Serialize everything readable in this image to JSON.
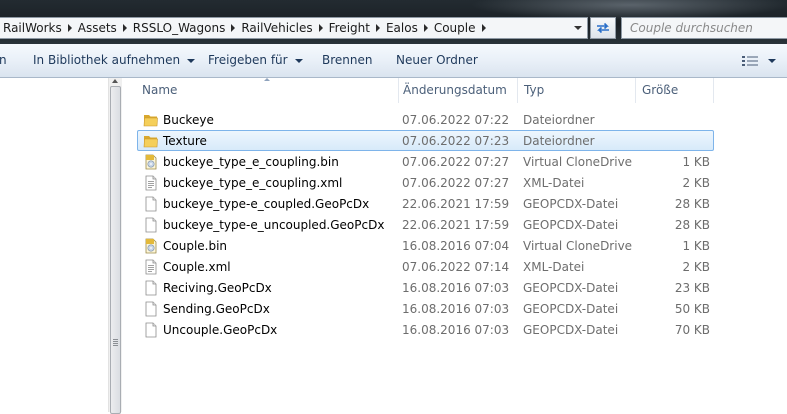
{
  "address_bar": {
    "crumbs": [
      "RailWorks",
      "Assets",
      "RSSLO_Wagons",
      "RailVehicles",
      "Freight",
      "Ealos",
      "Couple"
    ]
  },
  "search": {
    "placeholder": "Couple durchsuchen"
  },
  "toolbar": {
    "organize_partial": "n",
    "library_label": "In Bibliothek aufnehmen",
    "share_label": "Freigeben für",
    "burn_label": "Brennen",
    "new_folder_label": "Neuer Ordner"
  },
  "columns": {
    "name": "Name",
    "date": "Änderungsdatum",
    "type": "Typ",
    "size": "Größe"
  },
  "files": [
    {
      "name": "Buckeye",
      "date": "07.06.2022 07:22",
      "type": "Dateiordner",
      "size": "",
      "icon": "folder-icon",
      "selected": false
    },
    {
      "name": "Texture",
      "date": "07.06.2022 07:23",
      "type": "Dateiordner",
      "size": "",
      "icon": "folder-icon",
      "selected": true
    },
    {
      "name": "buckeye_type_e_coupling.bin",
      "date": "07.06.2022 07:27",
      "type": "Virtual CloneDrive",
      "size": "1 KB",
      "icon": "disc-image-icon",
      "selected": false
    },
    {
      "name": "buckeye_type_e_coupling.xml",
      "date": "07.06.2022 07:27",
      "type": "XML-Datei",
      "size": "2 KB",
      "icon": "text-file-icon",
      "selected": false
    },
    {
      "name": "buckeye_type-e_coupled.GeoPcDx",
      "date": "22.06.2021 17:59",
      "type": "GEOPCDX-Datei",
      "size": "28 KB",
      "icon": "blank-file-icon",
      "selected": false
    },
    {
      "name": "buckeye_type-e_uncoupled.GeoPcDx",
      "date": "22.06.2021 17:59",
      "type": "GEOPCDX-Datei",
      "size": "28 KB",
      "icon": "blank-file-icon",
      "selected": false
    },
    {
      "name": "Couple.bin",
      "date": "16.08.2016 07:04",
      "type": "Virtual CloneDrive",
      "size": "1 KB",
      "icon": "disc-image-icon",
      "selected": false
    },
    {
      "name": "Couple.xml",
      "date": "07.06.2022 07:14",
      "type": "XML-Datei",
      "size": "2 KB",
      "icon": "text-file-icon",
      "selected": false
    },
    {
      "name": "Reciving.GeoPcDx",
      "date": "16.08.2016 07:03",
      "type": "GEOPCDX-Datei",
      "size": "23 KB",
      "icon": "blank-file-icon",
      "selected": false
    },
    {
      "name": "Sending.GeoPcDx",
      "date": "16.08.2016 07:03",
      "type": "GEOPCDX-Datei",
      "size": "50 KB",
      "icon": "blank-file-icon",
      "selected": false
    },
    {
      "name": "Uncouple.GeoPcDx",
      "date": "16.08.2016 07:03",
      "type": "GEOPCDX-Datei",
      "size": "70 KB",
      "icon": "blank-file-icon",
      "selected": false
    }
  ],
  "colors": {
    "selection_bg": "#d7eafa",
    "selection_border": "#7eb4ea",
    "toolbar_text": "#1e395b",
    "folder_yellow": "#f2c94c"
  }
}
